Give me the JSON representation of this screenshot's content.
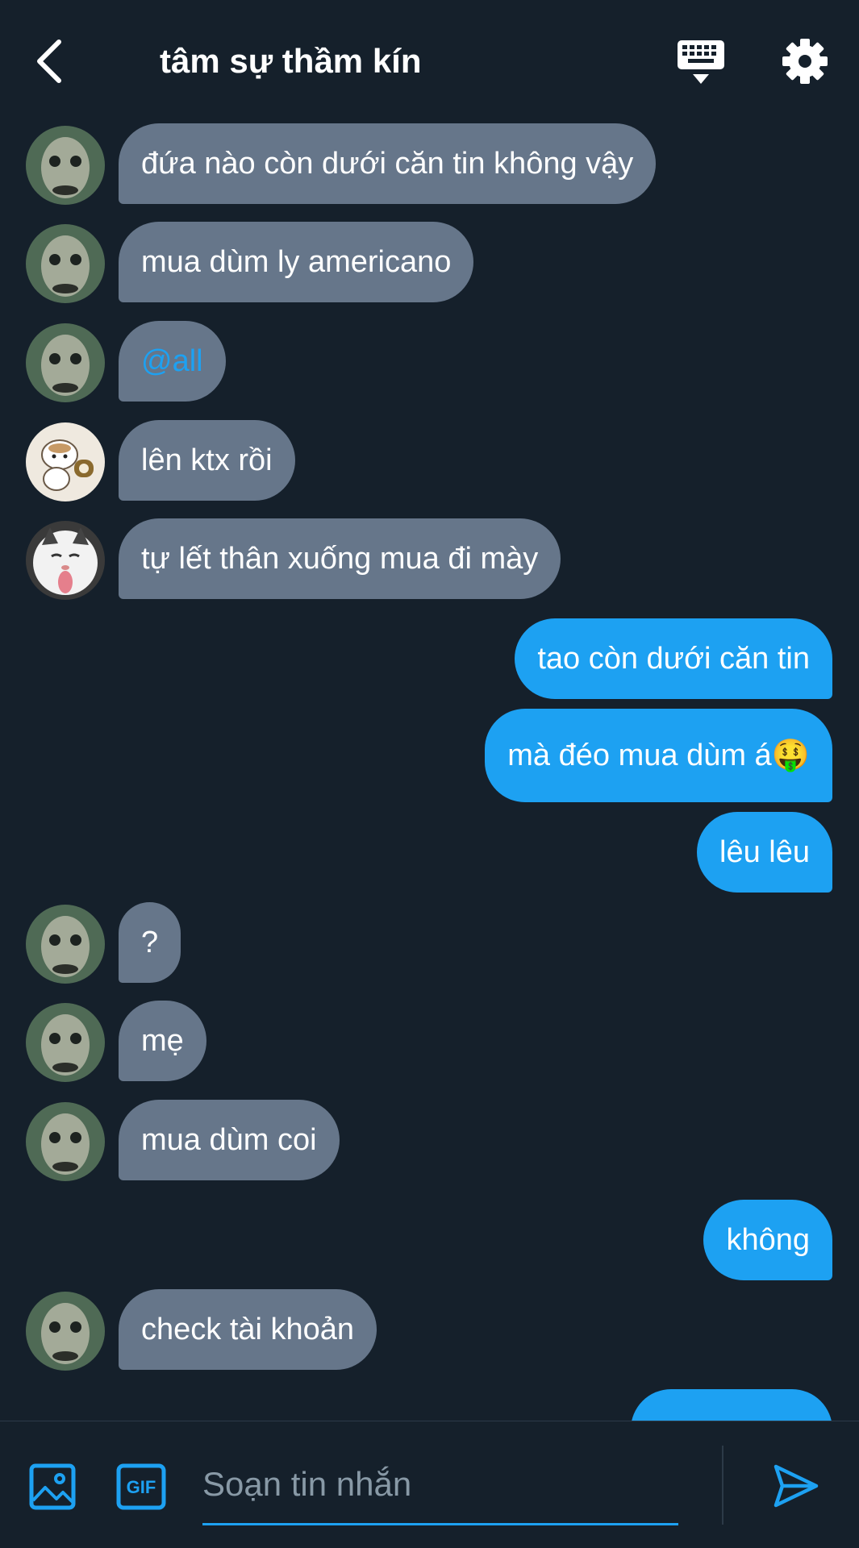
{
  "header": {
    "title": "tâm sự thầm kín",
    "icons": {
      "back": "chevron-left-icon",
      "keyboard": "keyboard-icon",
      "settings": "gear-icon"
    }
  },
  "messages": [
    {
      "side": "in",
      "sender": "fish-face",
      "text": "đứa nào còn dưới căn tin không vậy"
    },
    {
      "side": "in",
      "sender": "fish-face",
      "text": "mua dùm ly americano"
    },
    {
      "side": "in",
      "sender": "fish-face",
      "text": "@all"
    },
    {
      "side": "in",
      "sender": "hamster",
      "text": "lên ktx rồi"
    },
    {
      "side": "in",
      "sender": "cat",
      "text": "tự lết thân xuống mua đi mày"
    },
    {
      "side": "out",
      "text": "tao còn dưới căn tin"
    },
    {
      "side": "out",
      "text": "mà đéo mua dùm á🤑"
    },
    {
      "side": "out",
      "text": "lêu lêu"
    },
    {
      "side": "in",
      "sender": "fish-face",
      "text": "?"
    },
    {
      "side": "in",
      "sender": "fish-face",
      "text": "mẹ"
    },
    {
      "side": "in",
      "sender": "fish-face",
      "text": "mua dùm coi"
    },
    {
      "side": "out",
      "text": "không"
    },
    {
      "side": "in",
      "sender": "fish-face",
      "text": "check tài khoản"
    },
    {
      "side": "out",
      "text": ""
    }
  ],
  "composer": {
    "placeholder": "Soạn tin nhắn",
    "value": "",
    "gif_label": "GIF",
    "icons": {
      "image": "image-icon",
      "gif": "gif-icon",
      "send": "send-icon"
    }
  },
  "colors": {
    "background": "#15202b",
    "incoming_bubble": "#66768a",
    "outgoing_bubble": "#1da1f2",
    "accent": "#1da1f2",
    "placeholder": "#8899a6"
  }
}
